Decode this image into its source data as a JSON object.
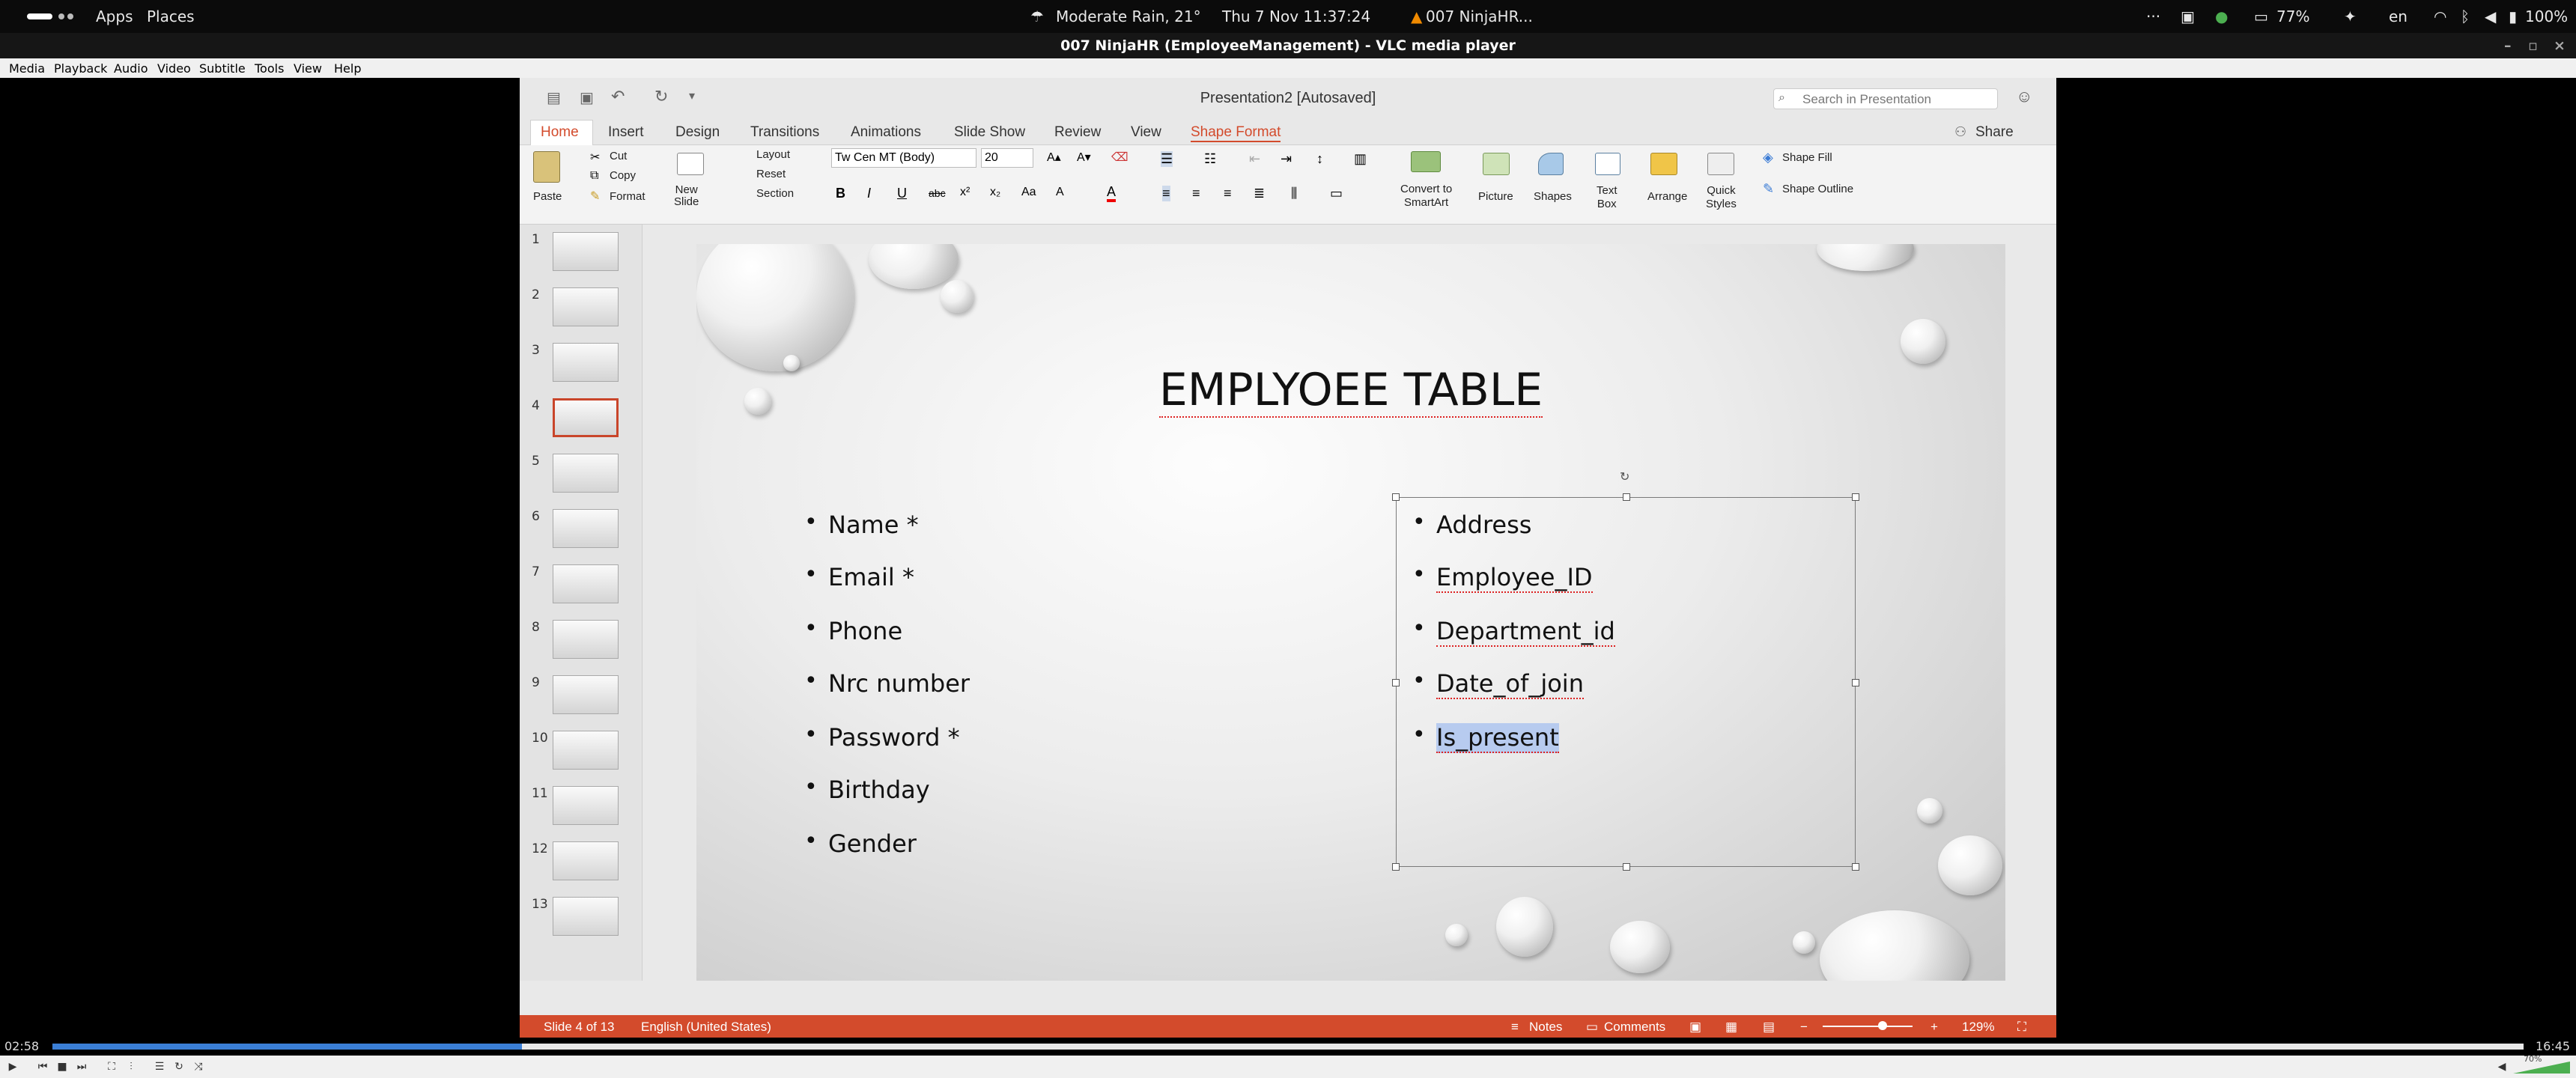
{
  "topbar": {
    "apps": "Apps",
    "places": "Places",
    "weather": "Moderate Rain, 21°",
    "datetime": "Thu 7 Nov  11:37:24",
    "active_app": "007 NinjaHR...",
    "dots": "···",
    "battery": "77%",
    "lang": "en",
    "volume_pct": "100%"
  },
  "window": {
    "title": "007 NinjaHR (EmployeeManagement) - VLC media player"
  },
  "vlc_menu": [
    "Media",
    "Playback",
    "Audio",
    "Video",
    "Subtitle",
    "Tools",
    "View",
    "Help"
  ],
  "ppt": {
    "doc_title": "Presentation2 [Autosaved]",
    "search_placeholder": "Search in Presentation",
    "share": "Share",
    "tabs": [
      "Home",
      "Insert",
      "Design",
      "Transitions",
      "Animations",
      "Slide Show",
      "Review",
      "View",
      "Shape Format"
    ],
    "ribbon": {
      "paste": "Paste",
      "cut": "Cut",
      "copy": "Copy",
      "format": "Format",
      "new_slide": "New\nSlide",
      "layout": "Layout",
      "reset": "Reset",
      "section": "Section",
      "font": "Tw Cen MT (Body)",
      "size": "20",
      "convert": "Convert to\nSmartArt",
      "picture": "Picture",
      "shapes": "Shapes",
      "textbox": "Text\nBox",
      "arrange": "Arrange",
      "quick_styles": "Quick\nStyles",
      "shape_fill": "Shape Fill",
      "shape_outline": "Shape Outline"
    },
    "slide_numbers": [
      "1",
      "2",
      "3",
      "4",
      "5",
      "6",
      "7",
      "8",
      "9",
      "10",
      "11",
      "12",
      "13"
    ],
    "slide": {
      "title": "EMPLYOEE TABLE",
      "left_items": [
        "Name *",
        "Email *",
        "Phone",
        "Nrc number",
        "Password *",
        "Birthday",
        "Gender"
      ],
      "right_items": [
        "Address",
        "Employee_ID",
        "Department_id",
        "Date_of_join",
        "Is_present"
      ]
    },
    "status": {
      "slide": "Slide 4 of 13",
      "language": "English (United States)",
      "notes": "Notes",
      "comments": "Comments",
      "zoom": "129%"
    }
  },
  "player": {
    "elapsed": "02:58",
    "total": "16:45",
    "progress": 0.19,
    "volume": "70%"
  }
}
